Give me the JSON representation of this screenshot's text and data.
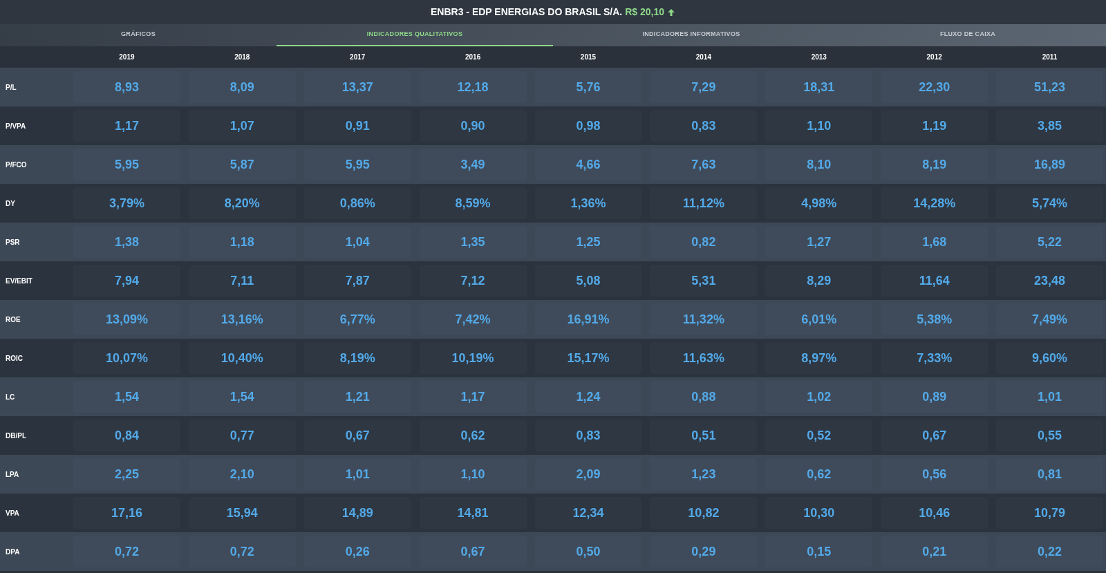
{
  "header": {
    "title": "ENBR3 - EDP ENERGIAS DO BRASIL S/A.",
    "price": "R$ 20,10",
    "price_up": true
  },
  "tabs": [
    {
      "label": "GRÁFICOS",
      "selected": false
    },
    {
      "label": "INDICADORES QUALITATIVOS",
      "selected": true
    },
    {
      "label": "INDICADORES INFORMATIVOS",
      "selected": false
    },
    {
      "label": "FLUXO DE CAIXA",
      "selected": false
    }
  ],
  "table": {
    "columns": [
      "2019",
      "2018",
      "2017",
      "2016",
      "2015",
      "2014",
      "2013",
      "2012",
      "2011"
    ],
    "rows": [
      {
        "label": "P/L",
        "values": [
          "8,93",
          "8,09",
          "13,37",
          "12,18",
          "5,76",
          "7,29",
          "18,31",
          "22,30",
          "51,23"
        ]
      },
      {
        "label": "P/VPA",
        "values": [
          "1,17",
          "1,07",
          "0,91",
          "0,90",
          "0,98",
          "0,83",
          "1,10",
          "1,19",
          "3,85"
        ]
      },
      {
        "label": "P/FCO",
        "values": [
          "5,95",
          "5,87",
          "5,95",
          "3,49",
          "4,66",
          "7,63",
          "8,10",
          "8,19",
          "16,89"
        ]
      },
      {
        "label": "DY",
        "values": [
          "3,79%",
          "8,20%",
          "0,86%",
          "8,59%",
          "1,36%",
          "11,12%",
          "4,98%",
          "14,28%",
          "5,74%"
        ]
      },
      {
        "label": "PSR",
        "values": [
          "1,38",
          "1,18",
          "1,04",
          "1,35",
          "1,25",
          "0,82",
          "1,27",
          "1,68",
          "5,22"
        ]
      },
      {
        "label": "EV/EBIT",
        "values": [
          "7,94",
          "7,11",
          "7,87",
          "7,12",
          "5,08",
          "5,31",
          "8,29",
          "11,64",
          "23,48"
        ]
      },
      {
        "label": "ROE",
        "values": [
          "13,09%",
          "13,16%",
          "6,77%",
          "7,42%",
          "16,91%",
          "11,32%",
          "6,01%",
          "5,38%",
          "7,49%"
        ]
      },
      {
        "label": "ROIC",
        "values": [
          "10,07%",
          "10,40%",
          "8,19%",
          "10,19%",
          "15,17%",
          "11,63%",
          "8,97%",
          "7,33%",
          "9,60%"
        ]
      },
      {
        "label": "LC",
        "values": [
          "1,54",
          "1,54",
          "1,21",
          "1,17",
          "1,24",
          "0,88",
          "1,02",
          "0,89",
          "1,01"
        ]
      },
      {
        "label": "DB/PL",
        "values": [
          "0,84",
          "0,77",
          "0,67",
          "0,62",
          "0,83",
          "0,51",
          "0,52",
          "0,67",
          "0,55"
        ]
      },
      {
        "label": "LPA",
        "values": [
          "2,25",
          "2,10",
          "1,01",
          "1,10",
          "2,09",
          "1,23",
          "0,62",
          "0,56",
          "0,81"
        ]
      },
      {
        "label": "VPA",
        "values": [
          "17,16",
          "15,94",
          "14,89",
          "14,81",
          "12,34",
          "10,82",
          "10,30",
          "10,46",
          "10,79"
        ]
      },
      {
        "label": "DPA",
        "values": [
          "0,72",
          "0,72",
          "0,26",
          "0,67",
          "0,50",
          "0,29",
          "0,15",
          "0,21",
          "0,22"
        ]
      }
    ]
  }
}
